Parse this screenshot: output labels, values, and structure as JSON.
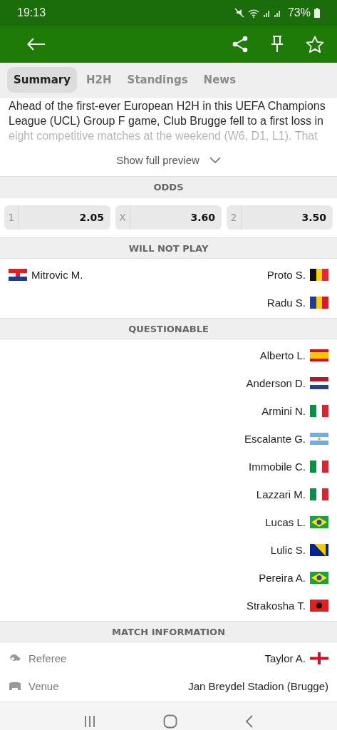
{
  "status_bar": {
    "time": "19:13",
    "battery": "73%"
  },
  "tabs": [
    {
      "label": "Summary",
      "selected": true
    },
    {
      "label": "H2H",
      "selected": false
    },
    {
      "label": "Standings",
      "selected": false
    },
    {
      "label": "News",
      "selected": false
    }
  ],
  "preview": {
    "text": "Ahead of the first-ever European H2H in this UEFA Champions League (UCL) Group F game, Club Brugge fell to a first loss in eight competitive matches at the weekend (W6, D1, L1). That",
    "action": "Show full preview"
  },
  "odds": {
    "title": "ODDS",
    "items": [
      {
        "label": "1",
        "value": "2.05"
      },
      {
        "label": "X",
        "value": "3.60"
      },
      {
        "label": "2",
        "value": "3.50"
      }
    ]
  },
  "will_not_play": {
    "title": "WILL NOT PLAY",
    "home": [
      {
        "name": "Mitrovic M.",
        "kind": "hr"
      }
    ],
    "away": [
      {
        "name": "Proto S.",
        "kind": "be"
      },
      {
        "name": "Radu S.",
        "kind": "ro"
      }
    ]
  },
  "questionable": {
    "title": "QUESTIONABLE",
    "away": [
      {
        "name": "Alberto L.",
        "kind": "es"
      },
      {
        "name": "Anderson D.",
        "kind": "nl"
      },
      {
        "name": "Armini N.",
        "kind": "it"
      },
      {
        "name": "Escalante G.",
        "kind": "ar"
      },
      {
        "name": "Immobile C.",
        "kind": "it"
      },
      {
        "name": "Lazzari M.",
        "kind": "it"
      },
      {
        "name": "Lucas L.",
        "kind": "br"
      },
      {
        "name": "Lulic S.",
        "kind": "ba"
      },
      {
        "name": "Pereira A.",
        "kind": "br"
      },
      {
        "name": "Strakosha T.",
        "kind": "al"
      }
    ]
  },
  "match_information": {
    "title": "MATCH INFORMATION",
    "rows": [
      {
        "kind": "referee",
        "label": "Referee",
        "value": "Taylor A.",
        "flag": {
          "kind": "en"
        }
      },
      {
        "kind": "venue",
        "label": "Venue",
        "value": "Jan Breydel Stadion (Brugge)"
      }
    ]
  }
}
